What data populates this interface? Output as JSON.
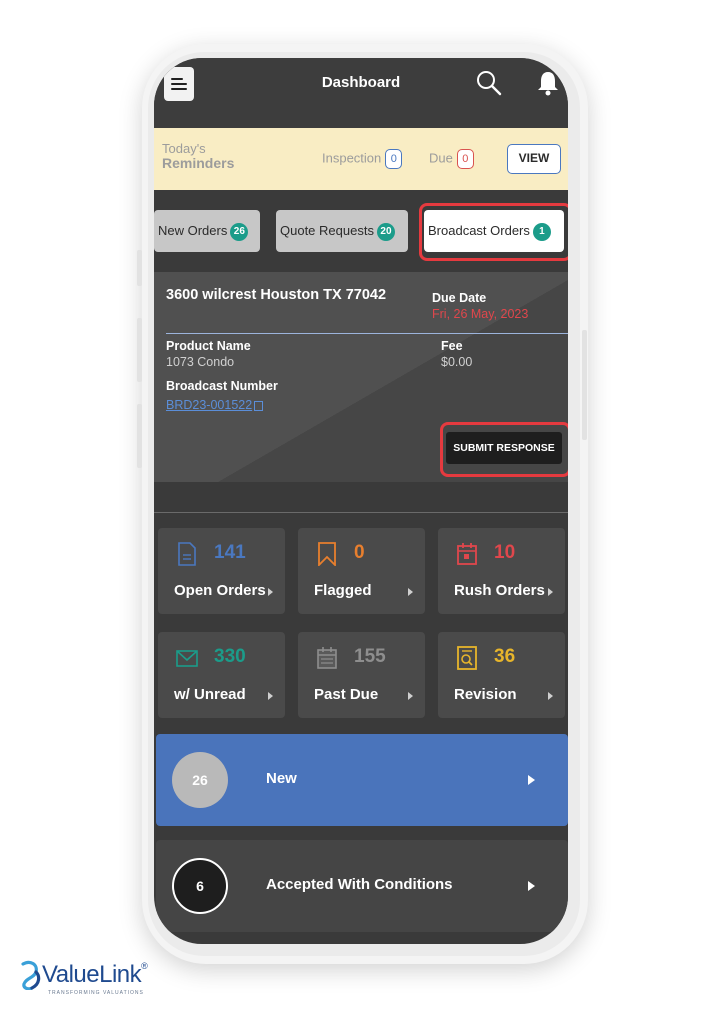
{
  "header": {
    "title": "Dashboard",
    "menu_icon": "menu-icon",
    "search_icon": "search-icon",
    "bell_icon": "bell-icon"
  },
  "reminders": {
    "title_line1": "Today's",
    "title_line2": "Reminders",
    "inspection_label": "Inspection",
    "inspection_count": "0",
    "due_label": "Due",
    "due_count": "0",
    "view_label": "VIEW"
  },
  "tabs": [
    {
      "label": "New Orders",
      "count": "26",
      "active": false
    },
    {
      "label": "Quote Requests",
      "count": "20",
      "active": false
    },
    {
      "label": "Broadcast Orders",
      "count": "1",
      "active": true
    }
  ],
  "broadcast_card": {
    "address": "3600 wilcrest Houston  TX 77042",
    "due_date_label": "Due Date",
    "due_date_value": "Fri, 26 May, 2023",
    "product_name_label": "Product Name",
    "product_name_value": "1073 Condo",
    "fee_label": "Fee",
    "fee_value": "$0.00",
    "broadcast_number_label": "Broadcast Number",
    "broadcast_number_value": "BRD23-001522",
    "submit_label": "SUBMIT RESPONSE"
  },
  "stats": [
    {
      "icon": "document-icon",
      "count": "141",
      "label": "Open Orders",
      "color": "#4a78c0"
    },
    {
      "icon": "bookmark-icon",
      "count": "0",
      "label": "Flagged",
      "color": "#e87f2e"
    },
    {
      "icon": "calendar-icon",
      "count": "10",
      "label": "Rush Orders",
      "color": "#e0474c"
    },
    {
      "icon": "mail-icon",
      "count": "330",
      "label": "w/ Unread",
      "color": "#1b9c8a"
    },
    {
      "icon": "calendar-grid-icon",
      "count": "155",
      "label": "Past Due",
      "color": "#8e8e8e"
    },
    {
      "icon": "search-document-icon",
      "count": "36",
      "label": "Revision",
      "color": "#e7b52b"
    }
  ],
  "statuses": [
    {
      "count": "26",
      "label": "New",
      "color": "#4a74bb"
    },
    {
      "count": "6",
      "label": "Accepted With Conditions",
      "color": "#454545"
    }
  ],
  "logo": {
    "brand": "ValueLink",
    "tagline": "TRANSFORMING VALUATIONS"
  }
}
